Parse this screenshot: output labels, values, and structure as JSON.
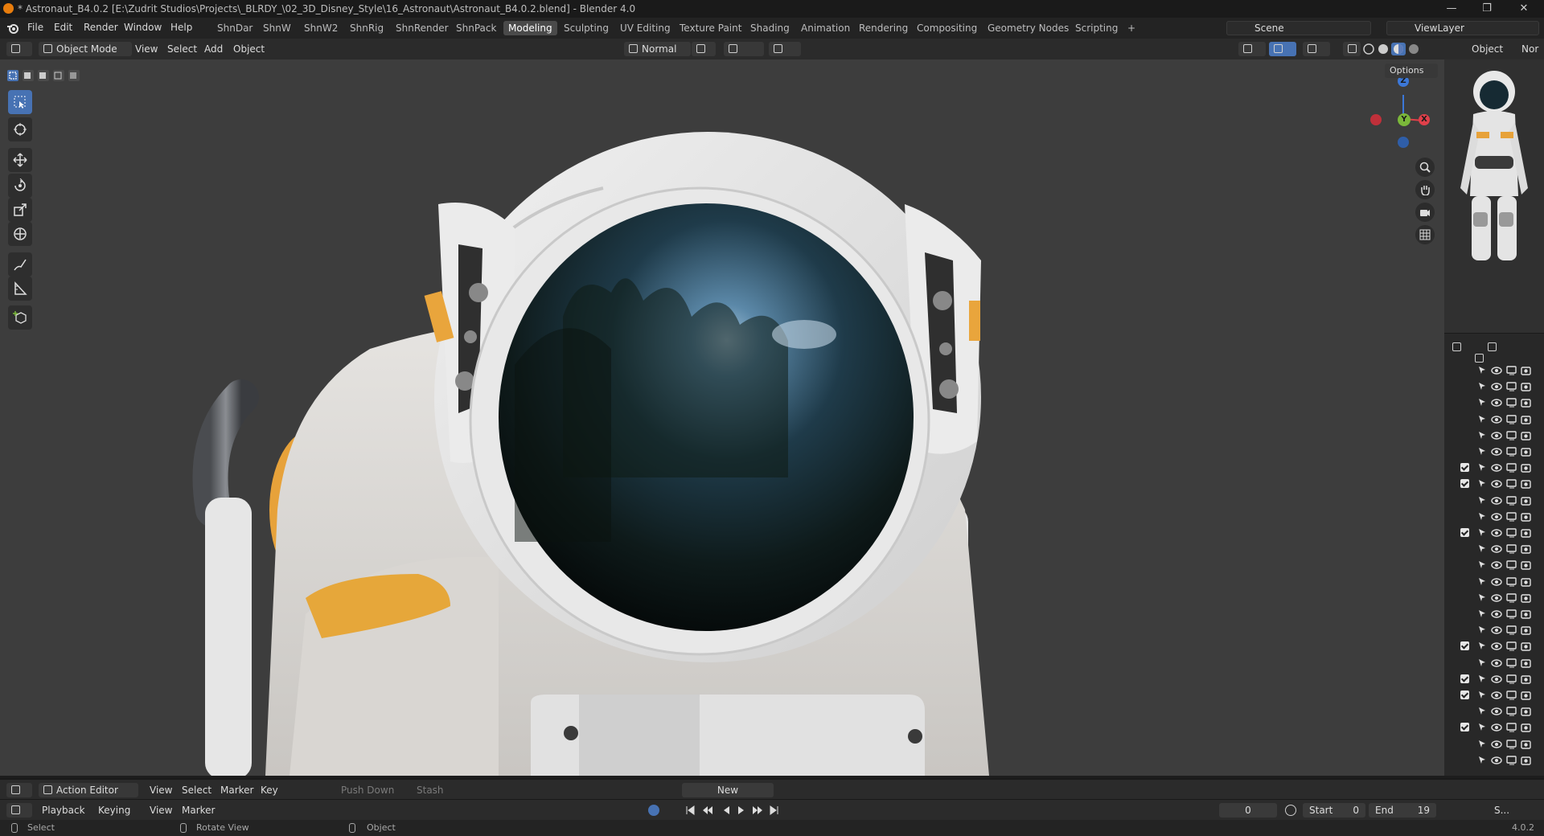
{
  "titlebar": {
    "title": "* Astronaut_B4.0.2 [E:\\Zudrit Studios\\Projects\\_BLRDY_\\02_3D_Disney_Style\\16_Astronaut\\Astronaut_B4.0.2.blend] - Blender 4.0",
    "minimize": "—",
    "maximize": "❐",
    "close": "✕"
  },
  "menu": [
    "File",
    "Edit",
    "Render",
    "Window",
    "Help"
  ],
  "workspaces": [
    "ShnDar",
    "ShnW",
    "ShnW2",
    "ShnRig",
    "ShnRender",
    "ShnPack",
    "Modeling",
    "Sculpting",
    "UV Editing",
    "Texture Paint",
    "Shading",
    "Animation",
    "Rendering",
    "Compositing",
    "Geometry Nodes",
    "Scripting"
  ],
  "active_workspace": "Modeling",
  "add_workspace": "+",
  "scene": {
    "name": "Scene"
  },
  "view_layer": {
    "name": "ViewLayer"
  },
  "viewport_header": {
    "mode": "Object Mode",
    "menus": [
      "View",
      "Select",
      "Add",
      "Object"
    ],
    "orientation": "Normal",
    "options": "Options"
  },
  "gizmo": {
    "z": "Z",
    "y": "Y",
    "x": "X"
  },
  "properties": {
    "tab": "Object",
    "partial": "Nor"
  },
  "action_editor": {
    "editor": "Action Editor",
    "menus": [
      "View",
      "Select",
      "Marker",
      "Key"
    ],
    "push_down": "Push Down",
    "stash": "Stash",
    "new": "New"
  },
  "timeline": {
    "menus": [
      "Playback",
      "Keying",
      "View",
      "Marker"
    ],
    "current_frame": "0",
    "start_label": "Start",
    "start": "0",
    "end_label": "End",
    "end": "19",
    "scene_short": "S..."
  },
  "statusbar": {
    "left": "Select",
    "middle": "Rotate View",
    "right": "Object",
    "version": "4.0.2"
  },
  "outliner": {
    "checked_rows": [
      6,
      7,
      10,
      17,
      19,
      20,
      22
    ],
    "row_count": 25
  },
  "colors": {
    "accent": "#4772b3",
    "brand_orange": "#e87d0d",
    "axis_x": "#e0404a",
    "axis_y": "#7bb83a",
    "axis_z": "#3c78d8"
  }
}
